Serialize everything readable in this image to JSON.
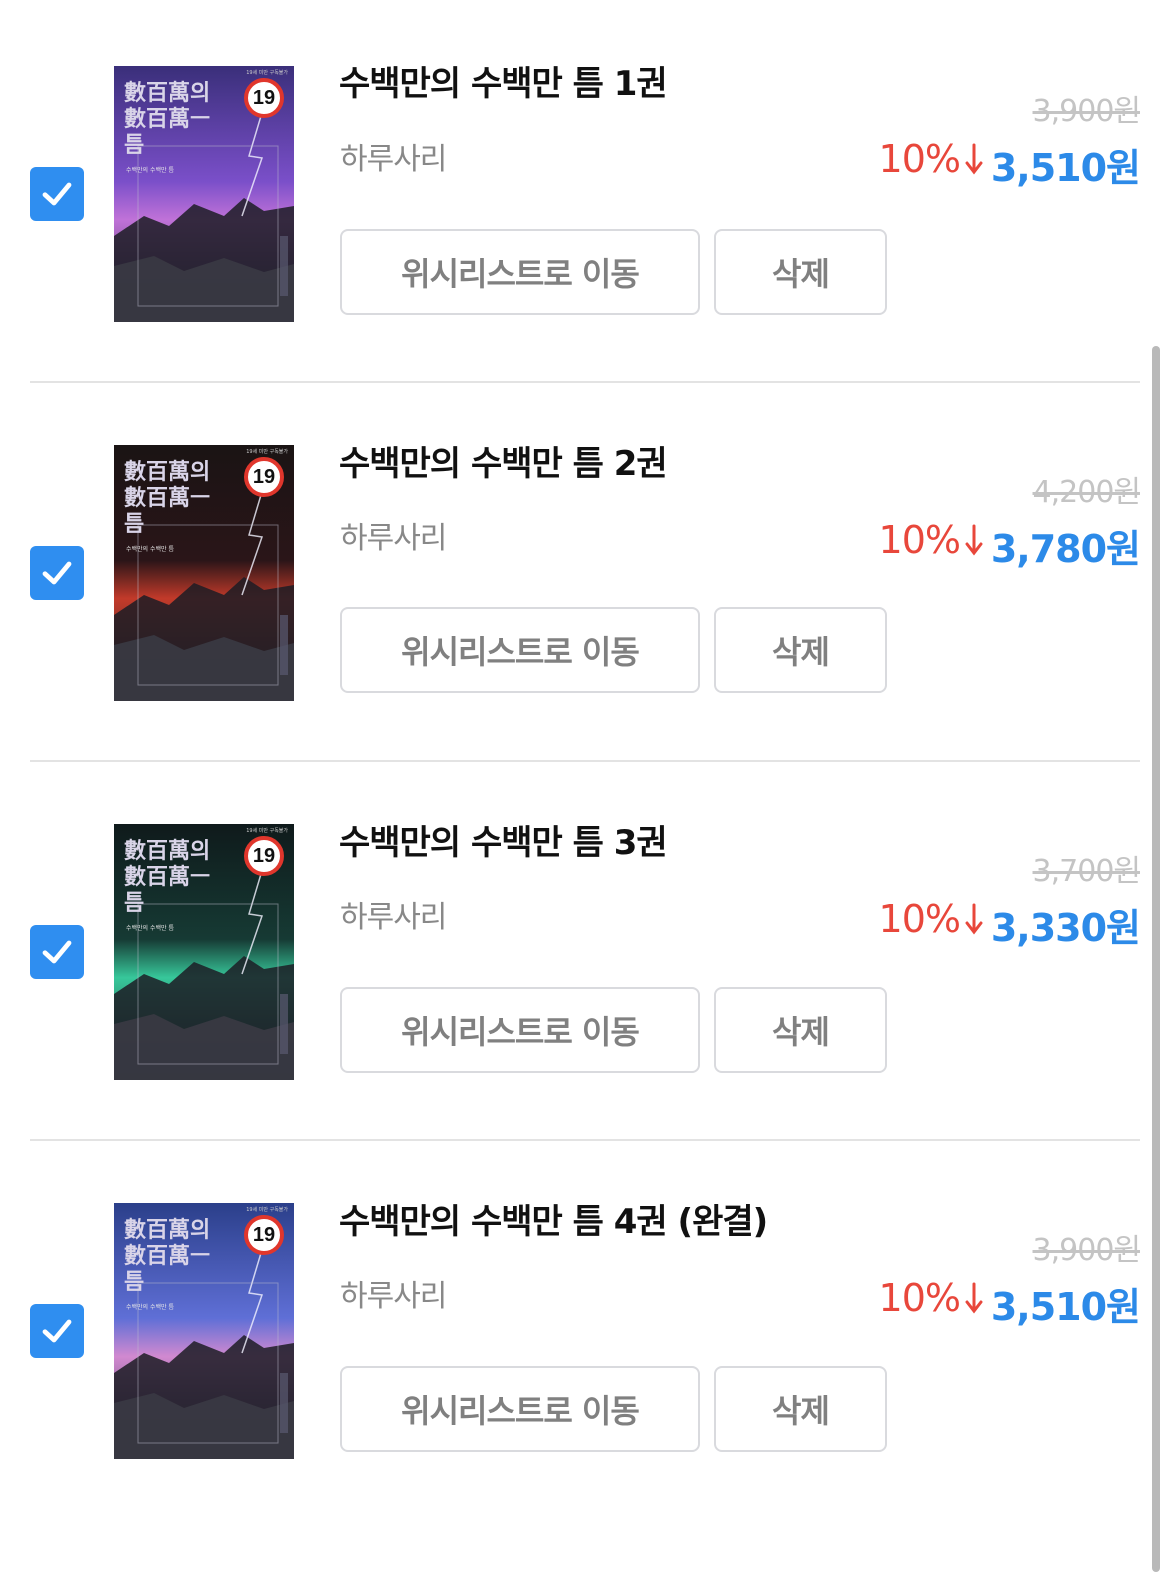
{
  "items": [
    {
      "title": "수백만의 수백만 틈 1권",
      "author": "하루사리",
      "original_price": "3,900원",
      "discount": "10%",
      "price": "3,510원",
      "wishlist_label": "위시리스트로 이동",
      "delete_label": "삭제",
      "checked": true,
      "cover": {
        "title_line1": "數百萬의",
        "title_line2": "數百萬ㅡ",
        "title_line3": "틈",
        "age": "19",
        "sub": "수백만의 수백만 틈",
        "colors": [
          "#3a2f7a",
          "#7a4fc9",
          "#c072d8",
          "#2c2b45"
        ]
      }
    },
    {
      "title": "수백만의 수백만 틈 2권",
      "author": "하루사리",
      "original_price": "4,200원",
      "discount": "10%",
      "price": "3,780원",
      "wishlist_label": "위시리스트로 이동",
      "delete_label": "삭제",
      "checked": true,
      "cover": {
        "title_line1": "數百萬의",
        "title_line2": "數百萬ㅡ",
        "title_line3": "틈",
        "age": "19",
        "sub": "수백만의 수백만 틈",
        "colors": [
          "#1a1414",
          "#2a1518",
          "#c23a2a",
          "#2b2b2b"
        ]
      }
    },
    {
      "title": "수백만의 수백만 틈 3권",
      "author": "하루사리",
      "original_price": "3,700원",
      "discount": "10%",
      "price": "3,330원",
      "wishlist_label": "위시리스트로 이동",
      "delete_label": "삭제",
      "checked": true,
      "cover": {
        "title_line1": "數百萬의",
        "title_line2": "數百萬ㅡ",
        "title_line3": "틈",
        "age": "19",
        "sub": "수백만의 수백만 틈",
        "colors": [
          "#0f1a1b",
          "#163a34",
          "#37c79a",
          "#1f3035"
        ]
      }
    },
    {
      "title": "수백만의 수백만 틈 4권 (완결)",
      "author": "하루사리",
      "original_price": "3,900원",
      "discount": "10%",
      "price": "3,510원",
      "wishlist_label": "위시리스트로 이동",
      "delete_label": "삭제",
      "checked": true,
      "cover": {
        "title_line1": "數百萬의",
        "title_line2": "數百萬ㅡ",
        "title_line3": "틈",
        "age": "19",
        "sub": "수백만의 수백만 틈",
        "colors": [
          "#2b3f8a",
          "#5f6fd6",
          "#d189d0",
          "#2a2d47"
        ]
      }
    }
  ],
  "icons": {
    "checkbox": "check-icon",
    "discount": "down-arrow-icon"
  },
  "colors": {
    "accent": "#2f8ef0",
    "price": "#2c8ae8",
    "discount": "#e8473b",
    "strike": "#c4c4c4"
  }
}
